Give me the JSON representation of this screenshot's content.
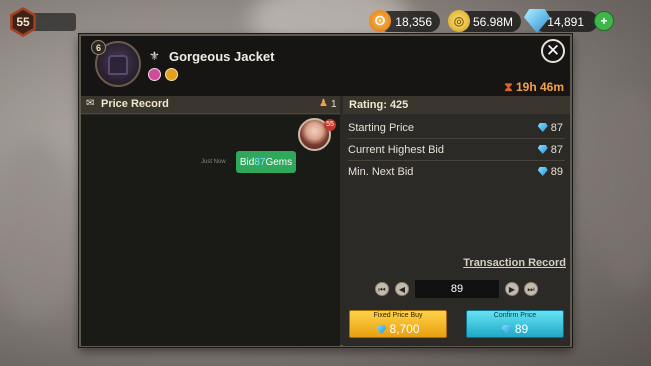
{
  "player": {
    "level": "55"
  },
  "resources": {
    "stamina": "18,356",
    "gold": "56.98M",
    "gems": "14,891",
    "add_label": "+"
  },
  "item": {
    "name": "Gorgeous Jacket",
    "level": "6",
    "timer": "19h 46m"
  },
  "price_record": {
    "title": "Price Record",
    "bidder_count": "1",
    "entries": [
      {
        "time": "Just Now",
        "bid_prefix": "Bid",
        "bid_amount": "87",
        "bid_suffix": "Gems",
        "avatar_level": "55"
      }
    ]
  },
  "auction": {
    "rating_label": "Rating: 425",
    "rows": [
      {
        "label": "Starting Price",
        "value": "87"
      },
      {
        "label": "Current Highest Bid",
        "value": "87"
      },
      {
        "label": "Min. Next Bid",
        "value": "89"
      }
    ],
    "transaction_record": "Transaction Record",
    "quantity": "89",
    "fixed_price_label": "Fixed Price Buy",
    "fixed_price_value": "8,700",
    "confirm_label": "Confirm Price",
    "confirm_value": "89"
  },
  "colors": {
    "accent_orange": "#f2a24a",
    "bid_green": "#2fa85b",
    "gem_blue": "#2e8fd6",
    "fixed_yellow": "#f2b21a",
    "confirm_cyan": "#29b9d4"
  }
}
